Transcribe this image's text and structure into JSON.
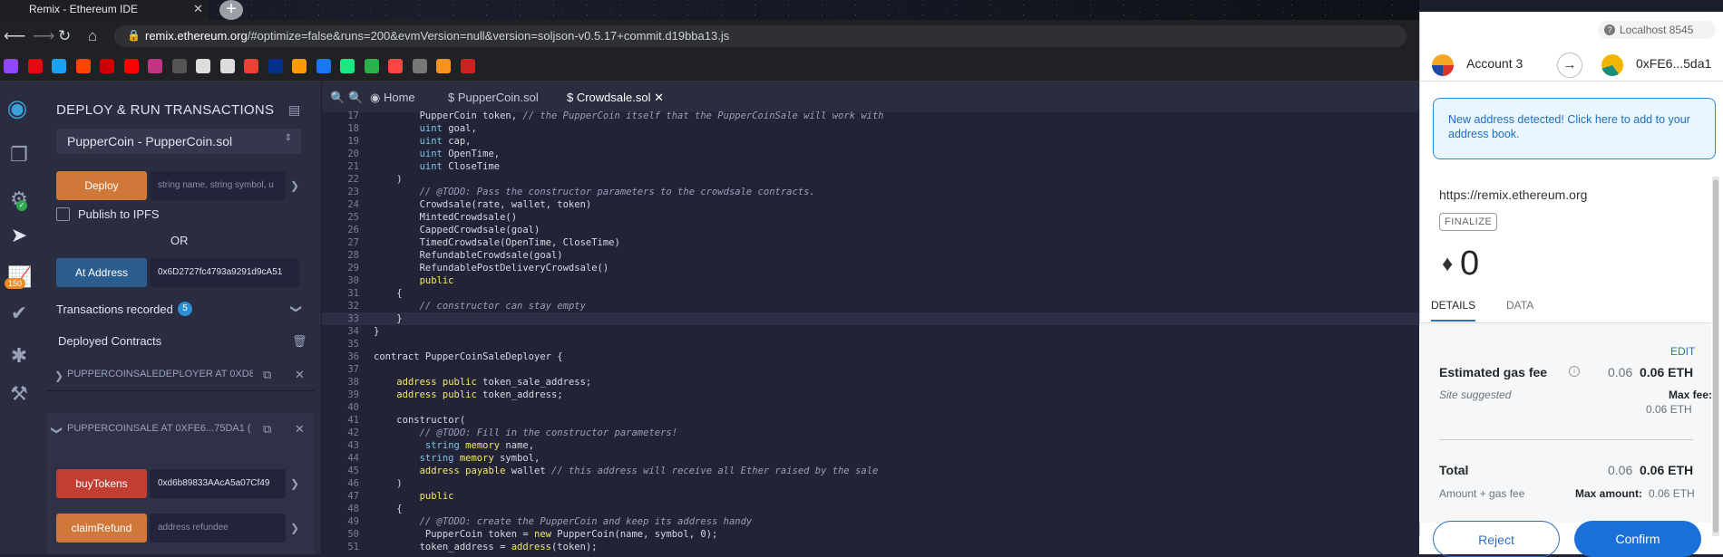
{
  "browser": {
    "tab_title": "Remix - Ethereum IDE",
    "tab_close": "✕",
    "new_tab": "+",
    "url_host": "remix.ethereum.org",
    "url_rest": "/#optimize=false&runs=200&evmVersion=null&version=soljson-v0.5.17+commit.d19bba13.js",
    "bookmark_icons": [
      "twitch",
      "netflix",
      "twitter",
      "reddit",
      "espn",
      "youtube",
      "instagram",
      "bnr",
      "fiu",
      "fiu2",
      "gmail",
      "paypal",
      "amazon",
      "facebook",
      "hulu",
      "feedly",
      "adblock",
      "notion",
      "shopify",
      "stopwatch"
    ]
  },
  "remix": {
    "side_title": "DEPLOY & RUN TRANSACTIONS",
    "contract_select": "PupperCoin - PupperCoin.sol",
    "deploy_label": "Deploy",
    "deploy_placeholder": "string name, string symbol, u",
    "publish_ipfs": "Publish to IPFS",
    "or": "OR",
    "at_address_label": "At Address",
    "at_address_value": "0x6D2727fc4793a9291d9cA51",
    "transactions_recorded": "Transactions recorded",
    "transactions_count": "5",
    "deployed_contracts": "Deployed Contracts",
    "instance1": "PUPPERCOINSALEDEPLOYER AT 0XD8E",
    "instance2": "PUPPERCOINSALE AT 0XFE6...75DA1 (",
    "buy_label": "buyTokens",
    "buy_value": "0xd6b89833AAcA5a07Cf49",
    "refund_label": "claimRefund",
    "refund_placeholder": "address refundee",
    "rail_badge": "150"
  },
  "editor": {
    "tabs": [
      {
        "label": "Home"
      },
      {
        "label": "PupperCoin.sol"
      },
      {
        "label": "Crowdsale.sol"
      }
    ],
    "lines": [
      {
        "n": "17",
        "t": "        PupperCoin token, // the PupperCoin itself that the PupperCoinSale will work with"
      },
      {
        "n": "18",
        "t": "        uint goal,"
      },
      {
        "n": "19",
        "t": "        uint cap,"
      },
      {
        "n": "20",
        "t": "        uint OpenTime,"
      },
      {
        "n": "21",
        "t": "        uint CloseTime"
      },
      {
        "n": "22",
        "t": "    )"
      },
      {
        "n": "23",
        "t": "        // @TODO: Pass the constructor parameters to the crowdsale contracts."
      },
      {
        "n": "24",
        "t": "        Crowdsale(rate, wallet, token)"
      },
      {
        "n": "25",
        "t": "        MintedCrowdsale()"
      },
      {
        "n": "26",
        "t": "        CappedCrowdsale(goal)"
      },
      {
        "n": "27",
        "t": "        TimedCrowdsale(OpenTime, CloseTime)"
      },
      {
        "n": "28",
        "t": "        RefundableCrowdsale(goal)"
      },
      {
        "n": "29",
        "t": "        RefundablePostDeliveryCrowdsale()"
      },
      {
        "n": "30",
        "t": "        public"
      },
      {
        "n": "31",
        "t": "    {"
      },
      {
        "n": "32",
        "t": "        // constructor can stay empty"
      },
      {
        "n": "33",
        "t": "    }"
      },
      {
        "n": "34",
        "t": "}"
      },
      {
        "n": "35",
        "t": ""
      },
      {
        "n": "36",
        "t": "contract PupperCoinSaleDeployer {"
      },
      {
        "n": "37",
        "t": ""
      },
      {
        "n": "38",
        "t": "    address public token_sale_address;"
      },
      {
        "n": "39",
        "t": "    address public token_address;"
      },
      {
        "n": "40",
        "t": ""
      },
      {
        "n": "41",
        "t": "    constructor("
      },
      {
        "n": "42",
        "t": "        // @TODO: Fill in the constructor parameters!"
      },
      {
        "n": "43",
        "t": "         string memory name,"
      },
      {
        "n": "44",
        "t": "        string memory symbol,"
      },
      {
        "n": "45",
        "t": "        address payable wallet // this address will receive all Ether raised by the sale"
      },
      {
        "n": "46",
        "t": "    )"
      },
      {
        "n": "47",
        "t": "        public"
      },
      {
        "n": "48",
        "t": "    {"
      },
      {
        "n": "49",
        "t": "        // @TODO: create the PupperCoin and keep its address handy"
      },
      {
        "n": "50",
        "t": "         PupperCoin token = new PupperCoin(name, symbol, 0);"
      },
      {
        "n": "51",
        "t": "        token_address = address(token);"
      }
    ]
  },
  "metamask": {
    "network": "Localhost 8545",
    "account_name": "Account 3",
    "recipient": "0xFE6...5da1",
    "notice": "New address detected! Click here to add to your address book.",
    "origin": "https://remix.ethereum.org",
    "badge": "FINALIZE",
    "amount": "0",
    "tab_details": "DETAILS",
    "tab_data": "DATA",
    "edit": "EDIT",
    "gas_label": "Estimated gas fee",
    "gas_value_light": "0.06",
    "gas_value_bold": "0.06 ETH",
    "site_suggested": "Site suggested",
    "max_fee_label": "Max fee:",
    "max_fee_value": "0.06 ETH",
    "total_label": "Total",
    "total_value_light": "0.06",
    "total_value_bold": "0.06 ETH",
    "amount_gas_label": "Amount + gas fee",
    "max_amount_label": "Max amount:",
    "max_amount_value": "0.06 ETH",
    "reject": "Reject",
    "confirm": "Confirm"
  }
}
